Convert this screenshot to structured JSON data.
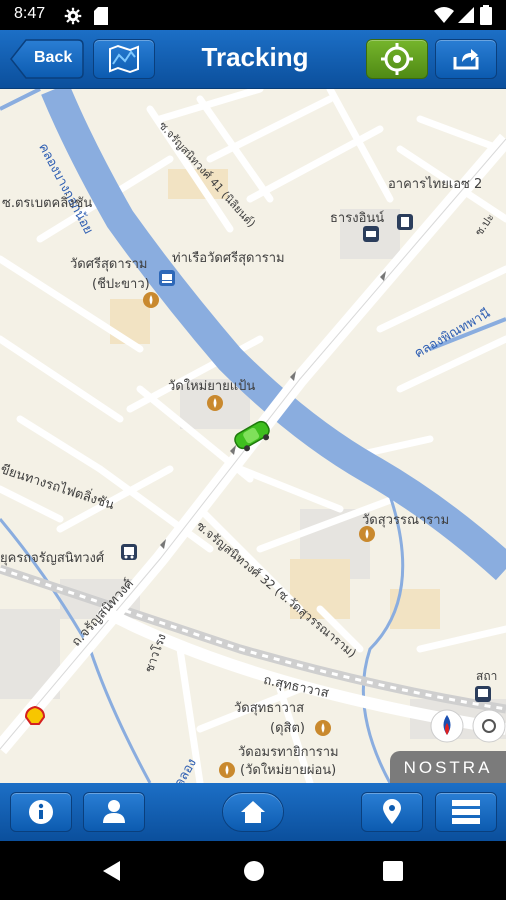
{
  "status_bar": {
    "time": "8:47",
    "icons": [
      "gear-icon",
      "sd-card-icon",
      "wifi-icon",
      "signal-icon",
      "battery-icon"
    ]
  },
  "header": {
    "back_label": "Back",
    "title": "Tracking",
    "buttons": [
      "map-icon",
      "locate-icon",
      "share-icon"
    ],
    "colors": {
      "bar": "#0b4f9c",
      "locate_active": "#5d9b1c"
    }
  },
  "map": {
    "watermark": "NOSTRA",
    "vehicle_icon": "green-car-icon",
    "labels": [
      "คลองบางกอกน้อย",
      "ซ.จรัญสนิทวงศ์ 41 (นิลิยนต์)",
      "อาคารไทยเอซ 2",
      "ธารงอินน์",
      "ซ.ตรเบตคลิ่งชัน",
      "วัดศรีสุดาราม",
      "(ชีปะขาว)",
      "ท่าเรือวัดศรีสุดาราม",
      "ซ.ปะ",
      "คลองพิณทพานี",
      "วัดใหม่ยายแป้น",
      "เขียนทางรถไฟตลิ่งชัน",
      "วัดสุวรรณาราม",
      "ซ.จรัญสนิทวงศ์ 32 (ซ.วัดสุวรรณาราม)",
      "ยุครถจรัญสนิทวงศ์",
      "ถ.จรัญสนิทวงศ์",
      "ชาวโรง",
      "ถ.สุทธาวาส",
      "วัดสุทธาวาส",
      "(ดุสิต)",
      "วัดอมรทายิการาม",
      "(วัดใหม่ยายผ่อน)",
      "คลอง",
      "สถา"
    ]
  },
  "bottom_bar": {
    "buttons": [
      "info-icon",
      "person-icon",
      "home-icon",
      "pin-icon",
      "list-icon"
    ]
  },
  "nav_bar": {
    "buttons": [
      "back-triangle-icon",
      "home-circle-icon",
      "recents-square-icon"
    ]
  }
}
